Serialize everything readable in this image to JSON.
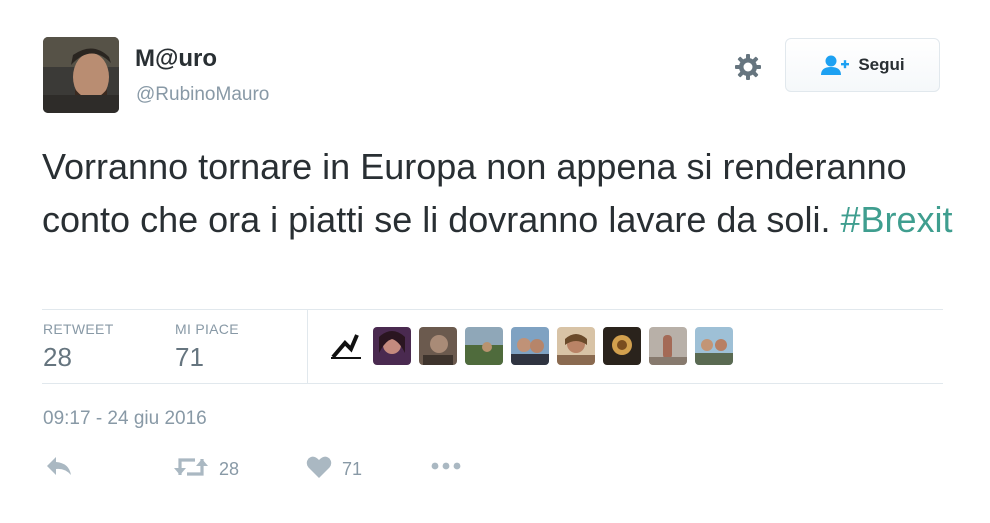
{
  "user": {
    "name": "M@uro",
    "handle": "@RubinoMauro"
  },
  "follow_button": {
    "label": "Segui"
  },
  "tweet": {
    "text": "Vorranno tornare in Europa non appena si renderanno conto che ora i piatti se li dovranno lavare da soli.",
    "hashtag": "#Brexit"
  },
  "stats": {
    "retweets_label": "RETWEET",
    "retweets": "28",
    "likes_label": "MI PIACE",
    "likes": "71"
  },
  "likers_count": 9,
  "timestamp": "09:17 - 24 giu 2016",
  "actions": {
    "reply": {
      "icon": "reply-icon"
    },
    "retweet": {
      "icon": "retweet-icon",
      "count": "28"
    },
    "like": {
      "icon": "heart-icon",
      "count": "71"
    },
    "more": {
      "icon": "more-icon"
    }
  },
  "colors": {
    "text": "#292f33",
    "muted": "#8899a6",
    "hashtag": "#3f9e8f",
    "follow_icon": "#1da1f2",
    "border": "#e1e8ed"
  }
}
